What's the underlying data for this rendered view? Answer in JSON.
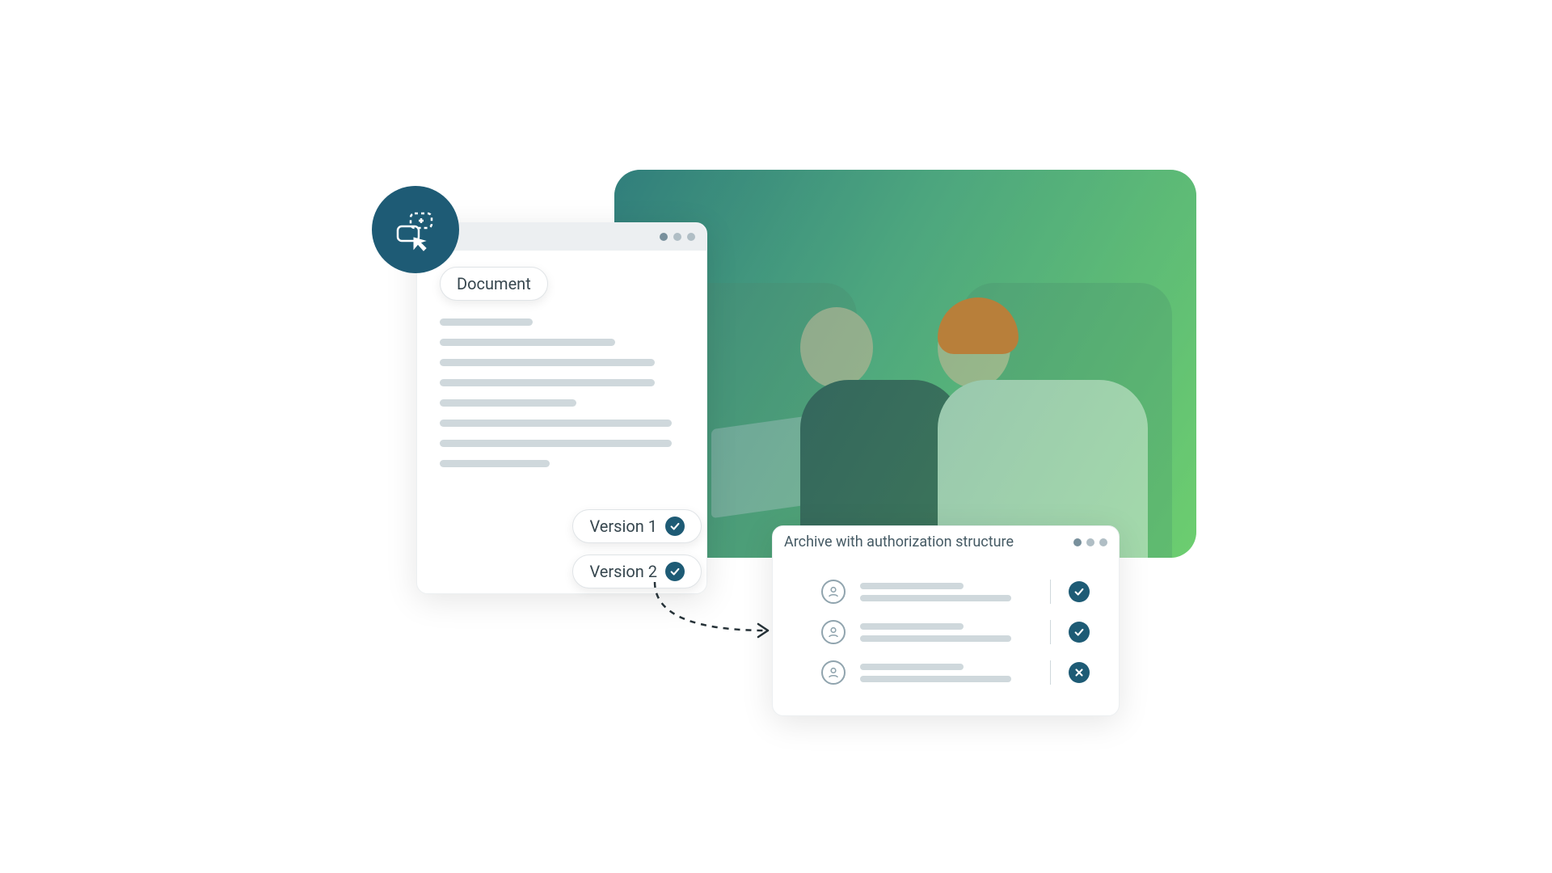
{
  "document_window": {
    "title_pill": "Document",
    "versions": [
      {
        "label": "Version 1",
        "status": "checked"
      },
      {
        "label": "Version 2",
        "status": "checked"
      }
    ]
  },
  "archive_window": {
    "title": "Archive with authorization structure",
    "rows": [
      {
        "status": "checked"
      },
      {
        "status": "checked"
      },
      {
        "status": "denied"
      }
    ]
  },
  "colors": {
    "accent": "#1e5b75",
    "skeleton": "#cfd8dc"
  }
}
